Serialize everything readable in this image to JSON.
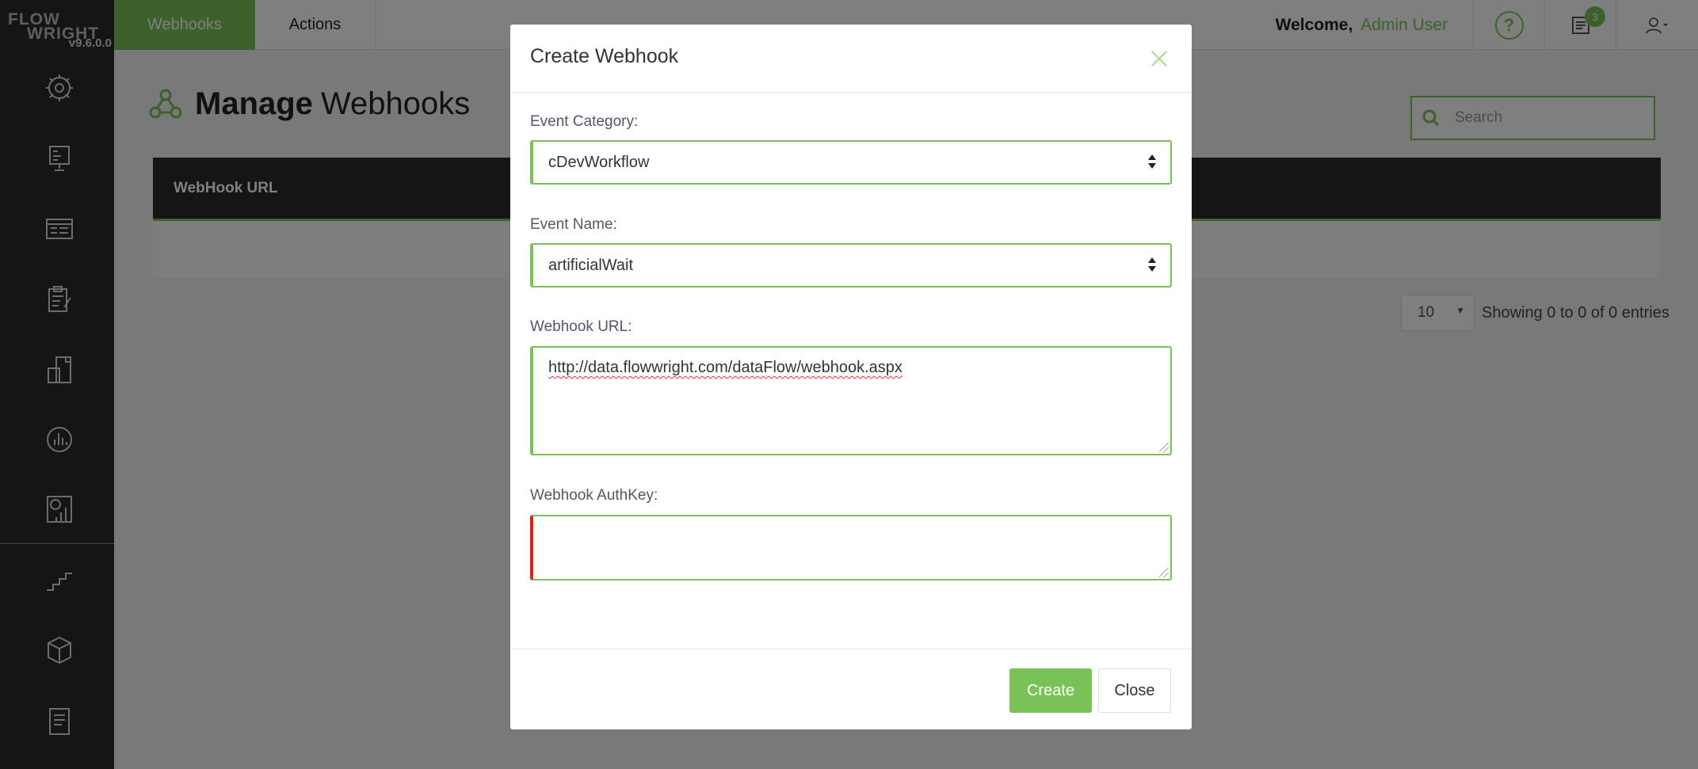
{
  "app": {
    "logo_line1": "FLOW",
    "logo_line2": "WRIGHT",
    "version": "v9.6.0.0"
  },
  "sidebar": {
    "items": [
      {
        "icon": "dashboard-gear-icon"
      },
      {
        "icon": "workflow-designer-icon"
      },
      {
        "icon": "forms-icon"
      },
      {
        "icon": "tasks-clipboard-icon"
      },
      {
        "icon": "documents-icon"
      },
      {
        "icon": "process-analytics-icon"
      },
      {
        "icon": "reports-icon"
      },
      {
        "icon": "stairs-icon"
      },
      {
        "icon": "package-box-icon"
      },
      {
        "icon": "notes-icon"
      }
    ]
  },
  "topbar": {
    "tabs": [
      {
        "label": "Webhooks"
      },
      {
        "label": "Actions"
      }
    ],
    "welcome": "Welcome,",
    "user_name": "Admin User",
    "help_symbol": "?",
    "notification_count": "3"
  },
  "page": {
    "title_bold": "Manage",
    "title_rest": "Webhooks",
    "search_placeholder": "Search",
    "table": {
      "columns": [
        "WebHook URL"
      ]
    },
    "page_size": "10",
    "entries_info": "Showing 0 to 0 of 0 entries"
  },
  "modal": {
    "title": "Create Webhook",
    "event_category_label": "Event Category:",
    "event_category_value": "cDevWorkflow",
    "event_name_label": "Event Name:",
    "event_name_value": "artificialWait",
    "webhook_url_label": "Webhook URL:",
    "webhook_url_value": "http://data.flowwright.com/dataFlow/webhook.aspx",
    "authkey_label": "Webhook AuthKey:",
    "authkey_value": "",
    "create_label": "Create",
    "close_label": "Close"
  },
  "colors": {
    "accent": "#78c257",
    "sidebar": "#2b2b2b",
    "error": "#e01e1e"
  }
}
